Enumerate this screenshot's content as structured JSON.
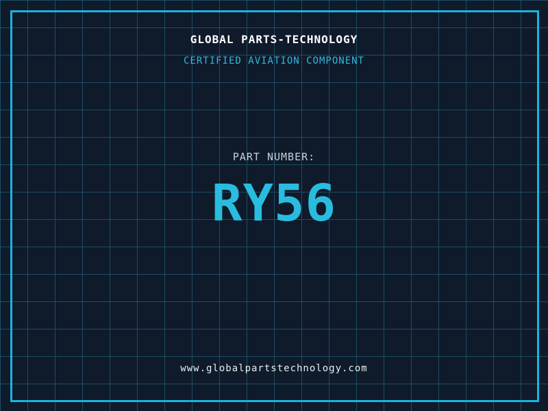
{
  "header": {
    "company": "GLOBAL PARTS-TECHNOLOGY",
    "tagline": "CERTIFIED AVIATION COMPONENT"
  },
  "part": {
    "label": "PART NUMBER:",
    "number": "RY56"
  },
  "footer": {
    "website": "www.globalpartstechnology.com"
  },
  "colors": {
    "background": "#0f1a2b",
    "grid_line": "#1d4e64",
    "frame_border": "#17b6de",
    "title_text": "#ffffff",
    "tagline_text": "#2fb9dc",
    "part_label_text": "#c9ced6",
    "part_number_text": "#29bcdf",
    "website_text": "#e9edf2"
  }
}
